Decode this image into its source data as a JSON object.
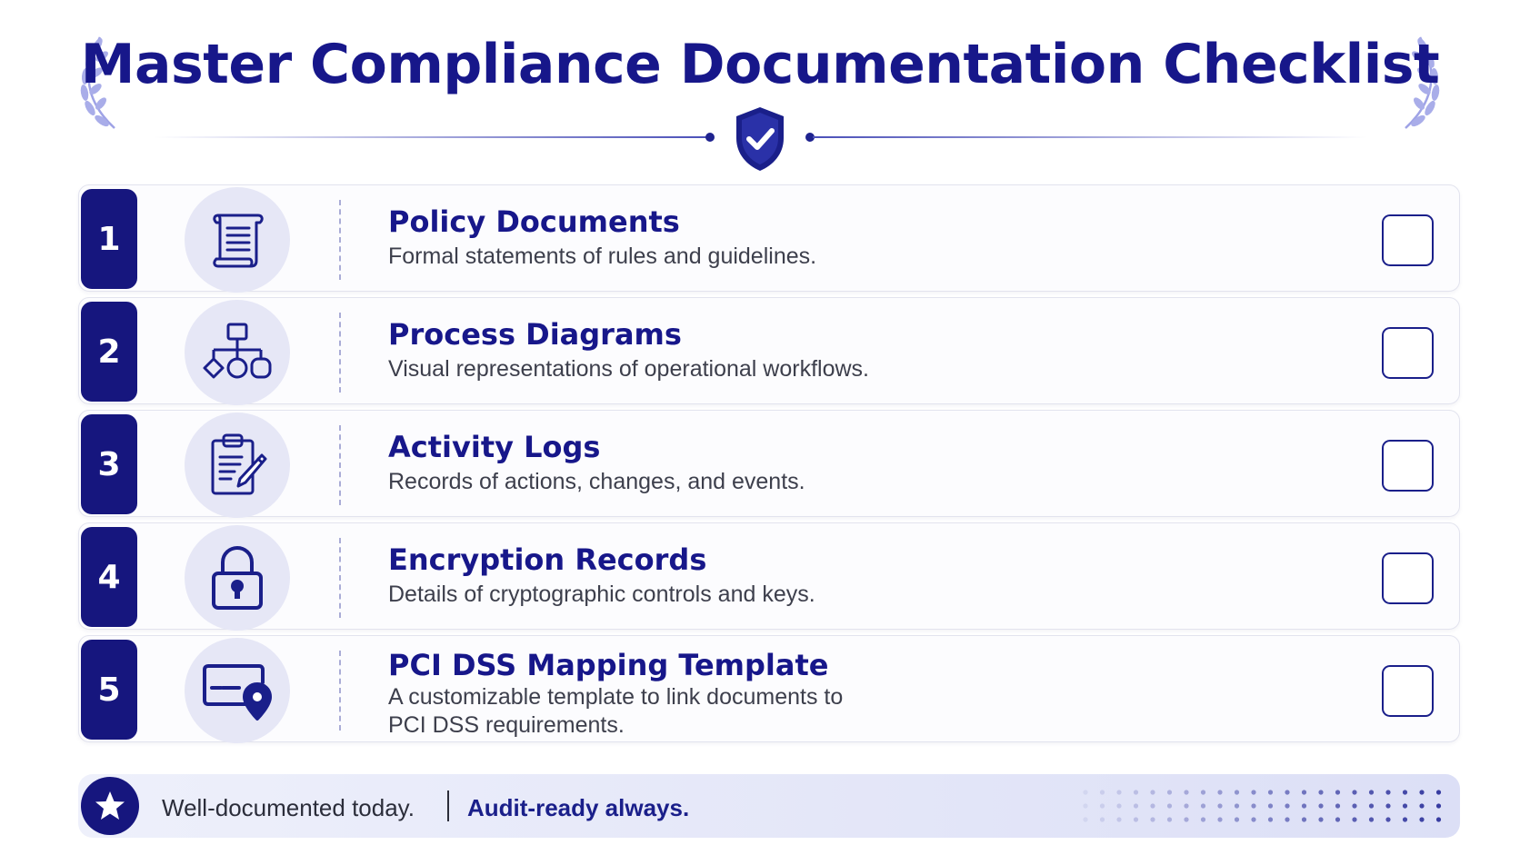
{
  "header": {
    "title": "Master Compliance Documentation Checklist"
  },
  "items": [
    {
      "number": "1",
      "icon": "scroll-document-icon",
      "title": "Policy Documents",
      "description": "Formal statements of rules and guidelines.",
      "checked": false
    },
    {
      "number": "2",
      "icon": "flowchart-icon",
      "title": "Process Diagrams",
      "description": "Visual representations of operational workflows.",
      "checked": false
    },
    {
      "number": "3",
      "icon": "clipboard-pen-icon",
      "title": "Activity Logs",
      "description": "Records of actions, changes, and events.",
      "checked": false
    },
    {
      "number": "4",
      "icon": "padlock-icon",
      "title": "Encryption Records",
      "description": "Details of cryptographic controls and keys.",
      "checked": false
    },
    {
      "number": "5",
      "icon": "card-location-icon",
      "title": "PCI DSS Mapping Template",
      "description": "A customizable template to link documents to PCI DSS requirements.",
      "checked": false
    }
  ],
  "footer": {
    "tagline": "Well-documented today.",
    "emphasis": "Audit-ready always."
  },
  "colors": {
    "primary": "#16167e",
    "icon_bg": "#e6e7f6",
    "text": "#3d3f4c",
    "laurel": "#8f94e0"
  }
}
